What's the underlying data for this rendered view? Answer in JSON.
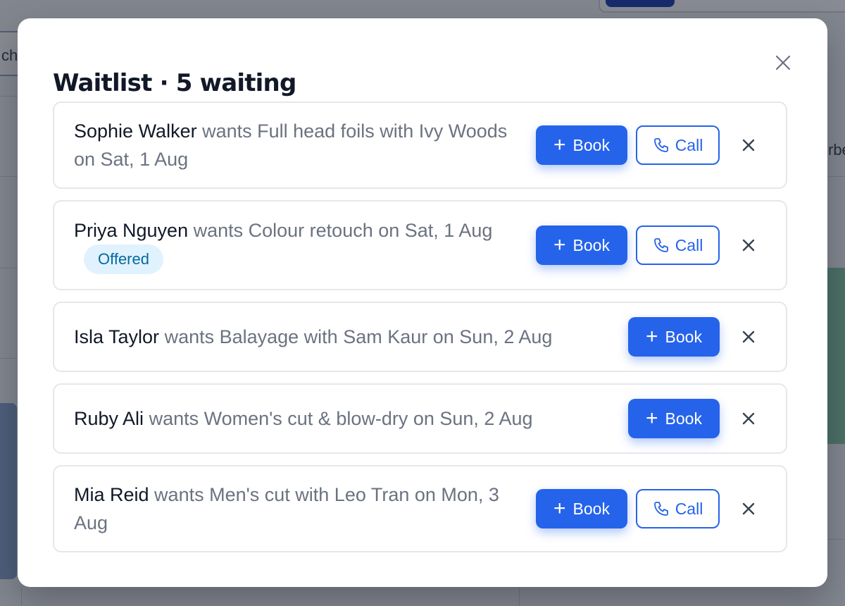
{
  "background": {
    "search_fragment": "ch",
    "right_fragment": "rbe"
  },
  "modal": {
    "title": "Waitlist · 5 waiting",
    "close_icon": "close-icon",
    "book_label": "Book",
    "call_label": "Call",
    "items": [
      {
        "name": "Sophie Walker",
        "request": " wants Full head foils with Ivy Woods on Sat, 1 Aug",
        "badge": "",
        "has_call": true
      },
      {
        "name": "Priya Nguyen",
        "request": " wants Colour retouch on Sat, 1 Aug",
        "badge": "Offered",
        "has_call": true
      },
      {
        "name": "Isla Taylor",
        "request": " wants Balayage with Sam Kaur on Sun, 2 Aug",
        "badge": "",
        "has_call": false
      },
      {
        "name": "Ruby Ali",
        "request": " wants Women's cut & blow-dry on Sun, 2 Aug",
        "badge": "",
        "has_call": false
      },
      {
        "name": "Mia Reid",
        "request": " wants Men's cut with Leo Tran on Mon, 3 Aug",
        "badge": "",
        "has_call": true
      }
    ]
  },
  "colors": {
    "primary": "#2563eb",
    "badge_bg": "#e0f2fe",
    "badge_text": "#0369a1",
    "muted_text": "#6b7280",
    "title_text": "#111827"
  }
}
